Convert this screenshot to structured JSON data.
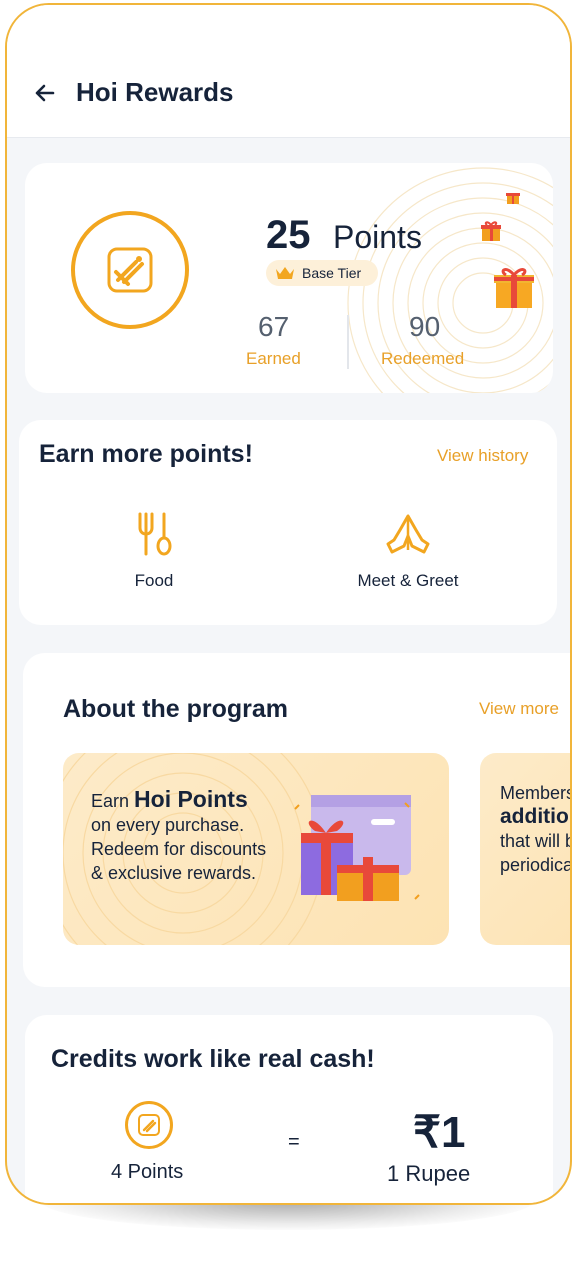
{
  "header": {
    "title": "Hoi Rewards",
    "back_icon": "arrow-left-icon"
  },
  "points": {
    "value": "25",
    "unit": "Points",
    "tier": "Base Tier",
    "earned_value": "67",
    "earned_label": "Earned",
    "redeemed_value": "90",
    "redeemed_label": "Redeemed"
  },
  "earn": {
    "title": "Earn more points!",
    "view_history": "View history",
    "categories": [
      {
        "label": "Food",
        "icon": "fork-spoon-icon"
      },
      {
        "label": "Meet & Greet",
        "icon": "namaste-hands-icon"
      }
    ]
  },
  "about": {
    "title": "About the program",
    "view_more": "View more",
    "promo1": {
      "line1_pre": "Earn ",
      "line1_bold": "Hoi Points",
      "line2": "on every purchase.",
      "line3": "Redeem for discounts",
      "line4": "& exclusive rewards."
    },
    "promo2": {
      "line1": "Members",
      "line2_bold": "addition",
      "line3": "that will b",
      "line4": "periodica"
    }
  },
  "credits": {
    "title": "Credits work like real cash!",
    "points_label": "4 Points",
    "equals": "=",
    "rupee_value": "₹1",
    "rupee_label": "1 Rupee"
  },
  "colors": {
    "accent": "#f2a61f",
    "text": "#16233a",
    "muted": "#55606f"
  }
}
